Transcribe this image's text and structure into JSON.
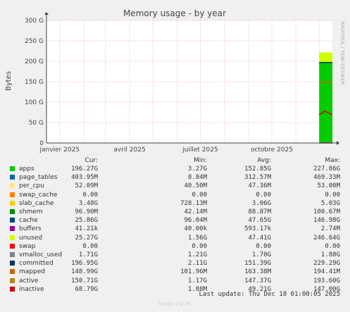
{
  "chart_data": {
    "type": "area",
    "title": "Memory usage - by year",
    "ylabel": "Bytes",
    "watermark": "RRDTOOL / TOBI OETIKER",
    "ylim": [
      0,
      300
    ],
    "y_unit": "G",
    "y_ticks": [
      "0",
      "50 G",
      "100 G",
      "150 G",
      "200 G",
      "250 G",
      "300 G"
    ],
    "x_ticks": [
      "janvier 2025",
      "avril 2025",
      "juillet 2025",
      "octobre 2025"
    ],
    "grid": true,
    "note": "data present only from ~mid-November 2025 onward; earlier period empty",
    "series": [
      {
        "name": "apps",
        "color": "#00cc00",
        "x": [
          "2025-12-01",
          "2025-12-08",
          "2025-12-18"
        ],
        "values": [
          196.27,
          196.27,
          196.27
        ]
      },
      {
        "name": "unused",
        "color": "#ccff00",
        "x": [
          "2025-12-01",
          "2025-12-08",
          "2025-12-18"
        ],
        "values": [
          25.27,
          25.27,
          25.27
        ]
      },
      {
        "name": "buffers",
        "color": "#990099",
        "x": [
          "2025-12-01",
          "2025-12-08",
          "2025-12-18"
        ],
        "values": [
          0.0,
          0.0,
          0.0
        ]
      },
      {
        "name": "committed",
        "color": "#003366",
        "x": [
          "2025-12-01",
          "2025-12-08",
          "2025-12-18"
        ],
        "values": [
          196.95,
          196.95,
          196.95
        ]
      },
      {
        "name": "mapped",
        "color": "#cc6600",
        "x": [
          "2025-12-01",
          "2025-12-08",
          "2025-12-18"
        ],
        "values": [
          148.99,
          148.99,
          148.99
        ]
      },
      {
        "name": "inactive",
        "color": "#cc0000",
        "x": [
          "2025-12-01",
          "2025-12-08",
          "2025-12-18"
        ],
        "values": [
          68.79,
          78.0,
          68.79
        ]
      }
    ]
  },
  "legend": {
    "headers": {
      "cur": "Cur:",
      "min": "Min:",
      "avg": "Avg:",
      "max": "Max:"
    },
    "rows": [
      {
        "name": "apps",
        "color": "#00cc00",
        "cur": "196.27G",
        "min": "3.27G",
        "avg": "152.85G",
        "max": "227.86G"
      },
      {
        "name": "page_tables",
        "color": "#0066b3",
        "cur": "403.95M",
        "min": "8.84M",
        "avg": "312.57M",
        "max": "469.33M"
      },
      {
        "name": "per_cpu",
        "color": "#ffe680",
        "cur": "52.09M",
        "min": "40.50M",
        "avg": "47.36M",
        "max": "53.00M"
      },
      {
        "name": "swap_cache",
        "color": "#ff8000",
        "cur": "0.00",
        "min": "0.00",
        "avg": "0.00",
        "max": "0.00"
      },
      {
        "name": "slab_cache",
        "color": "#ffcc00",
        "cur": "3.48G",
        "min": "728.13M",
        "avg": "3.06G",
        "max": "5.03G"
      },
      {
        "name": "shmem",
        "color": "#008f00",
        "cur": "96.90M",
        "min": "42.14M",
        "avg": "88.87M",
        "max": "100.67M"
      },
      {
        "name": "cache",
        "color": "#00487d",
        "cur": "25.86G",
        "min": "96.04M",
        "avg": "47.65G",
        "max": "146.98G"
      },
      {
        "name": "buffers",
        "color": "#990099",
        "cur": "41.21k",
        "min": "40.00k",
        "avg": "593.17k",
        "max": "2.74M"
      },
      {
        "name": "unused",
        "color": "#ccff00",
        "cur": "25.27G",
        "min": "1.56G",
        "avg": "47.41G",
        "max": "246.64G"
      },
      {
        "name": "swap",
        "color": "#ff0000",
        "cur": "0.00",
        "min": "0.00",
        "avg": "0.00",
        "max": "0.00"
      },
      {
        "name": "vmalloc_used",
        "color": "#808080",
        "cur": "1.71G",
        "min": "1.21G",
        "avg": "1.70G",
        "max": "1.88G"
      },
      {
        "name": "committed",
        "color": "#003366",
        "cur": "196.95G",
        "min": "2.11G",
        "avg": "151.39G",
        "max": "229.29G"
      },
      {
        "name": "mapped",
        "color": "#cc6600",
        "cur": "148.99G",
        "min": "101.96M",
        "avg": "163.38M",
        "max": "194.41M"
      },
      {
        "name": "active",
        "color": "#b8860b",
        "cur": "150.71G",
        "min": "1.17G",
        "avg": "147.37G",
        "max": "193.60G"
      },
      {
        "name": "inactive",
        "color": "#cc0000",
        "cur": "68.79G",
        "min": "1.88M",
        "avg": "49.21G",
        "max": "147.00G"
      }
    ]
  },
  "footer": {
    "last_update": "Last update: Thu Dec 18 01:00:05 2025",
    "version": "Munin 2.0.76"
  }
}
